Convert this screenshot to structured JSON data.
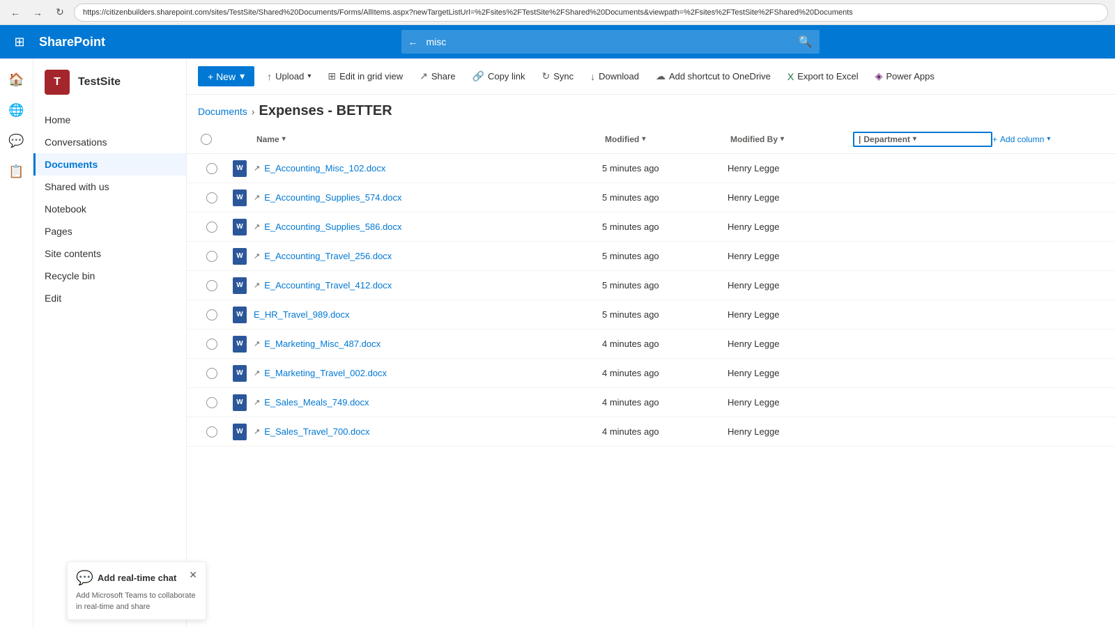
{
  "browser": {
    "url": "https://citizenbuilders.sharepoint.com/sites/TestSite/Shared%20Documents/Forms/AllItems.aspx?newTargetListUrl=%2Fsites%2FTestSite%2FShared%20Documents&viewpath=%2Fsites%2FTestSite%2FShared%20Documents",
    "search_value": "misc",
    "back_arrow": "←",
    "forward_arrow": "→",
    "reload": "↻"
  },
  "topnav": {
    "waffle_icon": "⊞",
    "app_name": "SharePoint",
    "search_placeholder": "misc",
    "search_back_icon": "←",
    "search_icon": "🔍"
  },
  "rail_icons": [
    "🏠",
    "🌐",
    "💬",
    "📋"
  ],
  "site": {
    "icon_letter": "T",
    "name": "TestSite"
  },
  "nav": {
    "items": [
      {
        "label": "Home",
        "active": false
      },
      {
        "label": "Conversations",
        "active": false
      },
      {
        "label": "Documents",
        "active": true
      },
      {
        "label": "Shared with us",
        "active": false
      },
      {
        "label": "Notebook",
        "active": false
      },
      {
        "label": "Pages",
        "active": false
      },
      {
        "label": "Site contents",
        "active": false
      },
      {
        "label": "Recycle bin",
        "active": false
      },
      {
        "label": "Edit",
        "active": false
      }
    ]
  },
  "toolbar": {
    "new_label": "+ New",
    "new_chevron": "▾",
    "upload_label": "Upload",
    "upload_icon": "↑",
    "grid_label": "Edit in grid view",
    "grid_icon": "⊞",
    "share_label": "Share",
    "share_icon": "↗",
    "copy_label": "Copy link",
    "copy_icon": "🔗",
    "sync_label": "Sync",
    "sync_icon": "↻",
    "download_label": "Download",
    "download_icon": "↓",
    "onedrive_label": "Add shortcut to OneDrive",
    "onedrive_icon": "☁",
    "export_label": "Export to Excel",
    "export_icon": "📊",
    "powerapps_label": "Power Apps",
    "powerapps_icon": "◈"
  },
  "breadcrumb": {
    "parent": "Documents",
    "separator": "›",
    "current": "Expenses - BETTER"
  },
  "table": {
    "columns": [
      {
        "label": ""
      },
      {
        "label": ""
      },
      {
        "label": "Name",
        "sortable": true
      },
      {
        "label": "Modified",
        "sortable": true
      },
      {
        "label": "Modified By",
        "sortable": true
      },
      {
        "label": "Department",
        "sortable": true,
        "highlighted": true
      },
      {
        "label": "Add column",
        "sortable": true,
        "add": true
      }
    ],
    "rows": [
      {
        "name": "E_Accounting_Misc_102.docx",
        "prefix": "↗",
        "modified": "5 minutes ago",
        "modified_by": "Henry Legge",
        "department": ""
      },
      {
        "name": "E_Accounting_Supplies_574.docx",
        "prefix": "↗",
        "modified": "5 minutes ago",
        "modified_by": "Henry Legge",
        "department": ""
      },
      {
        "name": "E_Accounting_Supplies_586.docx",
        "prefix": "↗",
        "modified": "5 minutes ago",
        "modified_by": "Henry Legge",
        "department": ""
      },
      {
        "name": "E_Accounting_Travel_256.docx",
        "prefix": "↗",
        "modified": "5 minutes ago",
        "modified_by": "Henry Legge",
        "department": ""
      },
      {
        "name": "E_Accounting_Travel_412.docx",
        "prefix": "↗",
        "modified": "5 minutes ago",
        "modified_by": "Henry Legge",
        "department": ""
      },
      {
        "name": "E_HR_Travel_989.docx",
        "prefix": "",
        "modified": "5 minutes ago",
        "modified_by": "Henry Legge",
        "department": ""
      },
      {
        "name": "E_Marketing_Misc_487.docx",
        "prefix": "↗",
        "modified": "4 minutes ago",
        "modified_by": "Henry Legge",
        "department": ""
      },
      {
        "name": "E_Marketing_Travel_002.docx",
        "prefix": "↗",
        "modified": "4 minutes ago",
        "modified_by": "Henry Legge",
        "department": ""
      },
      {
        "name": "E_Sales_Meals_749.docx",
        "prefix": "↗",
        "modified": "4 minutes ago",
        "modified_by": "Henry Legge",
        "department": ""
      },
      {
        "name": "E_Sales_Travel_700.docx",
        "prefix": "↗",
        "modified": "4 minutes ago",
        "modified_by": "Henry Legge",
        "department": ""
      }
    ]
  },
  "chat": {
    "icon": "💬",
    "title": "Add real-time chat",
    "description": "Add Microsoft Teams to collaborate in real-time and share",
    "close_icon": "✕"
  }
}
